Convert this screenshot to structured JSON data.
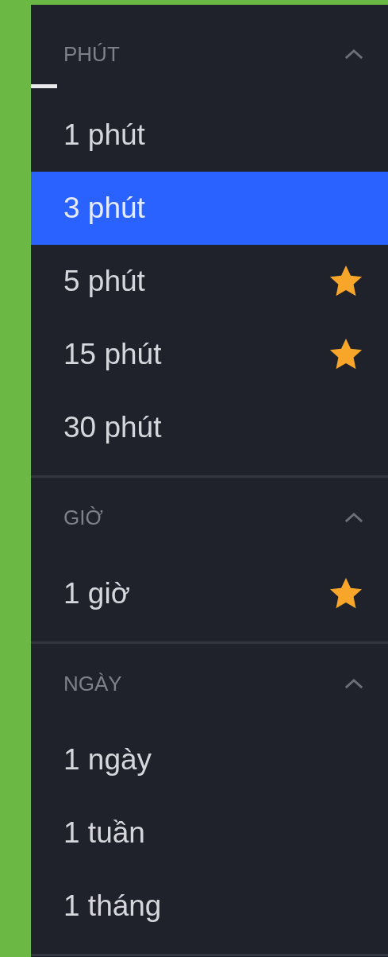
{
  "sections": [
    {
      "title": "PHÚT",
      "expanded": true,
      "items": [
        {
          "label": "1 phút",
          "selected": false,
          "favorite": false
        },
        {
          "label": "3 phút",
          "selected": true,
          "favorite": false
        },
        {
          "label": "5 phút",
          "selected": false,
          "favorite": true
        },
        {
          "label": "15 phút",
          "selected": false,
          "favorite": true
        },
        {
          "label": "30 phút",
          "selected": false,
          "favorite": false
        }
      ]
    },
    {
      "title": "GIỜ",
      "expanded": true,
      "items": [
        {
          "label": "1 giờ",
          "selected": false,
          "favorite": true
        }
      ]
    },
    {
      "title": "NGÀY",
      "expanded": true,
      "items": [
        {
          "label": "1 ngày",
          "selected": false,
          "favorite": false
        },
        {
          "label": "1 tuần",
          "selected": false,
          "favorite": false
        },
        {
          "label": "1 tháng",
          "selected": false,
          "favorite": false
        }
      ]
    }
  ]
}
